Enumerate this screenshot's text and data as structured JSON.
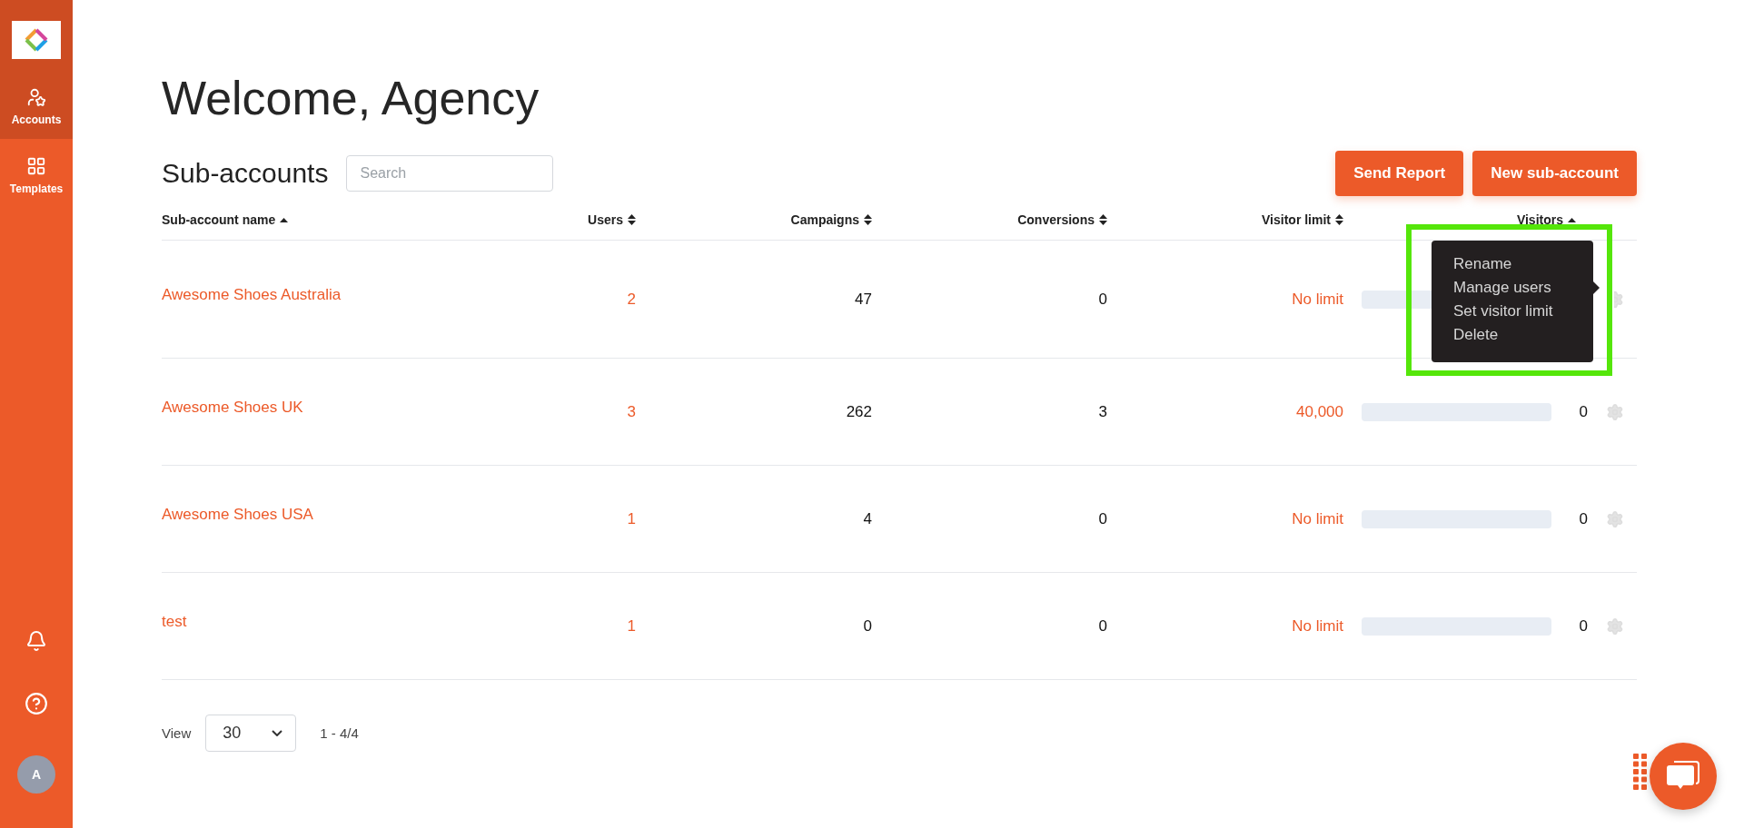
{
  "sidebar": {
    "items": [
      {
        "label": "Accounts",
        "selected": true
      },
      {
        "label": "Templates",
        "selected": false
      }
    ],
    "avatar": "A"
  },
  "title": "Welcome, Agency",
  "section": {
    "heading": "Sub-accounts",
    "search_placeholder": "Search",
    "buttons": [
      "Send Report",
      "New sub-account"
    ]
  },
  "table": {
    "columns": [
      {
        "label": "Sub-account name",
        "sorted": true
      },
      {
        "label": "Users",
        "sorted": false
      },
      {
        "label": "Campaigns",
        "sorted": false
      },
      {
        "label": "Conversions",
        "sorted": false
      },
      {
        "label": "Visitor limit",
        "sorted": false
      },
      {
        "label": "Visitors",
        "sorted": true
      }
    ],
    "rows": [
      {
        "name": "Awesome Shoes Australia",
        "users": "2",
        "campaigns": "47",
        "conversions": "0",
        "visitor_limit": "No limit"
      },
      {
        "name": "Awesome Shoes UK",
        "users": "3",
        "campaigns": "262",
        "conversions": "3",
        "visitor_limit": "40,000",
        "visitors": "0"
      },
      {
        "name": "Awesome Shoes USA",
        "users": "1",
        "campaigns": "4",
        "conversions": "0",
        "visitor_limit": "No limit",
        "visitors": "0"
      },
      {
        "name": "test",
        "users": "1",
        "campaigns": "0",
        "conversions": "0",
        "visitor_limit": "No limit",
        "visitors": "0"
      }
    ]
  },
  "context_menu": {
    "items": [
      "Rename",
      "Manage users",
      "Set visitor limit",
      "Delete"
    ],
    "highlighted": true
  },
  "pagination": {
    "label": "View",
    "page_size": "30",
    "range": "1 - 4/4"
  }
}
